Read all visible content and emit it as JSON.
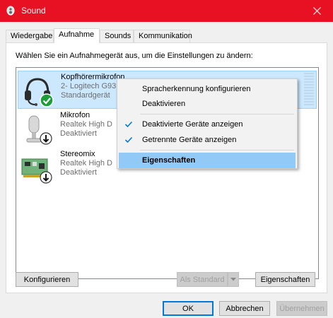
{
  "window": {
    "title": "Sound"
  },
  "tabs": [
    {
      "label": "Wiedergabe"
    },
    {
      "label": "Aufnahme"
    },
    {
      "label": "Sounds"
    },
    {
      "label": "Kommunikation"
    }
  ],
  "panel": {
    "instruction": "Wählen Sie ein Aufnahmegerät aus, um die Einstellungen zu ändern:"
  },
  "devices": [
    {
      "name": "Kopfhörermikrofon",
      "detail": "2- Logitech G93",
      "status": "Standardgerät",
      "icon": "headset-icon",
      "badge": "check-badge-icon"
    },
    {
      "name": "Mikrofon",
      "detail": "Realtek High D",
      "status": "Deaktiviert",
      "icon": "microphone-icon",
      "badge": "down-arrow-badge-icon"
    },
    {
      "name": "Stereomix",
      "detail": "Realtek High D",
      "status": "Deaktiviert",
      "icon": "circuit-board-icon",
      "badge": "down-arrow-badge-icon"
    }
  ],
  "context_menu": {
    "items": [
      {
        "label": "Spracherkennung konfigurieren"
      },
      {
        "label": "Deaktivieren"
      },
      {
        "label": "Deaktivierte Geräte anzeigen",
        "checked": true
      },
      {
        "label": "Getrennte Geräte anzeigen",
        "checked": true
      },
      {
        "label": "Eigenschaften"
      }
    ]
  },
  "buttons": {
    "configure": "Konfigurieren",
    "set_default": "Als Standard",
    "properties": "Eigenschaften",
    "ok": "OK",
    "cancel": "Abbrechen",
    "apply": "Übernehmen"
  },
  "colors": {
    "titlebar": "#e81123",
    "selection": "#cce8ff",
    "menu_highlight": "#91c9f7",
    "check": "#0078d7",
    "success": "#1e9e3a"
  }
}
